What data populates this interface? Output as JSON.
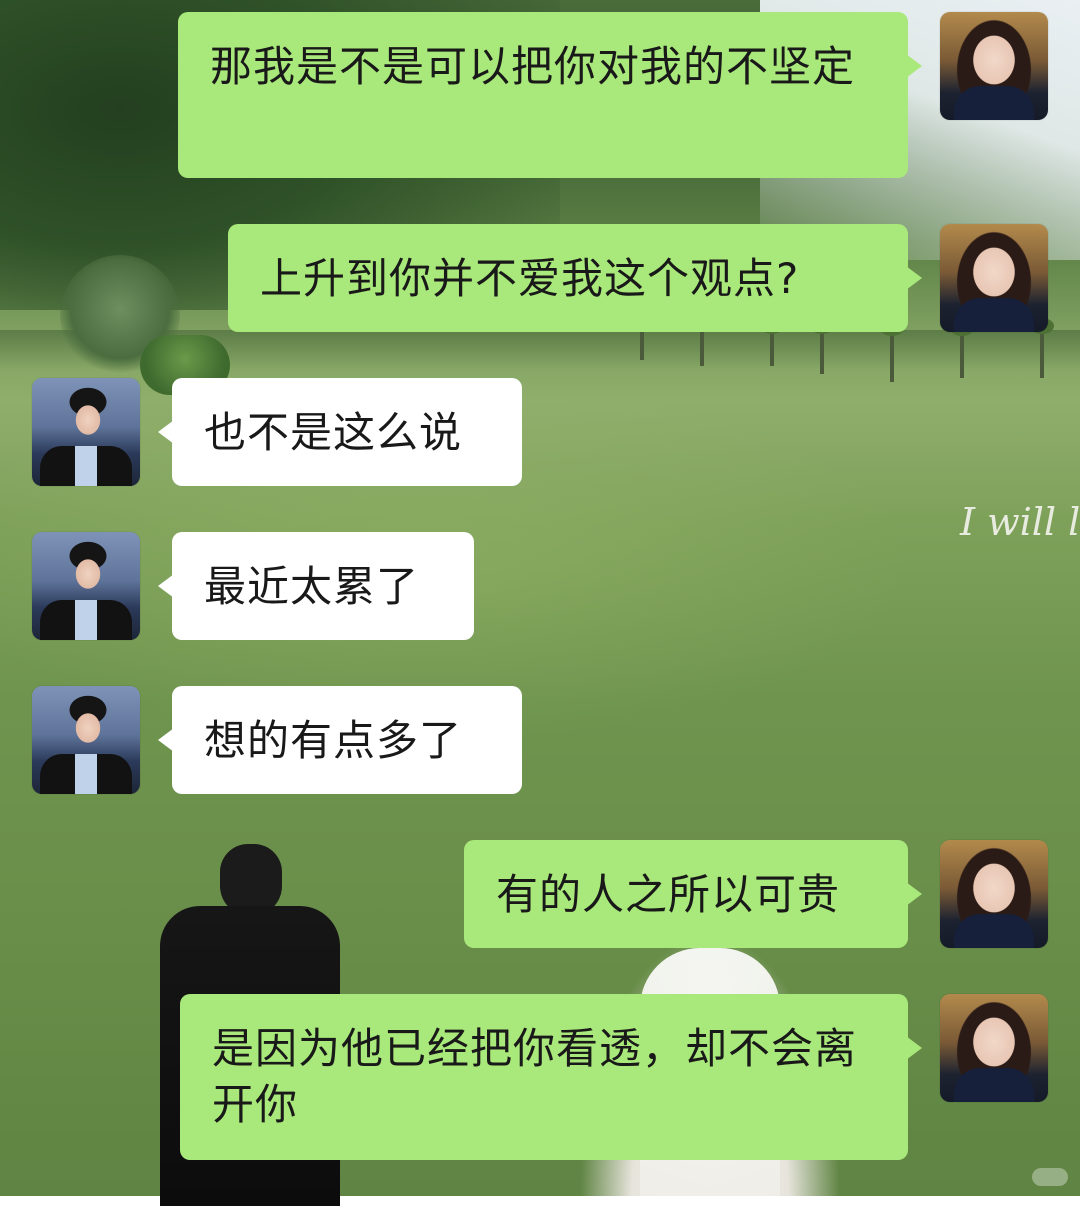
{
  "chat": {
    "messages": [
      {
        "sender": "her",
        "text": "那我是不是可以把你对我的不坚定"
      },
      {
        "sender": "her",
        "text": "上升到你并不爱我这个观点?"
      },
      {
        "sender": "him",
        "text": "也不是这么说"
      },
      {
        "sender": "him",
        "text": "最近太累了"
      },
      {
        "sender": "him",
        "text": "想的有点多了"
      },
      {
        "sender": "her",
        "text": "有的人之所以可贵"
      },
      {
        "sender": "her",
        "text": "是因为他已经把你看透，却不会离开你"
      }
    ]
  },
  "background": {
    "watermark": "I will lo"
  },
  "colors": {
    "sent_bubble": "#a9e87a",
    "received_bubble": "#ffffff"
  },
  "icons": {
    "her_avatar": "avatar-woman-icon",
    "him_avatar": "avatar-man-icon"
  }
}
